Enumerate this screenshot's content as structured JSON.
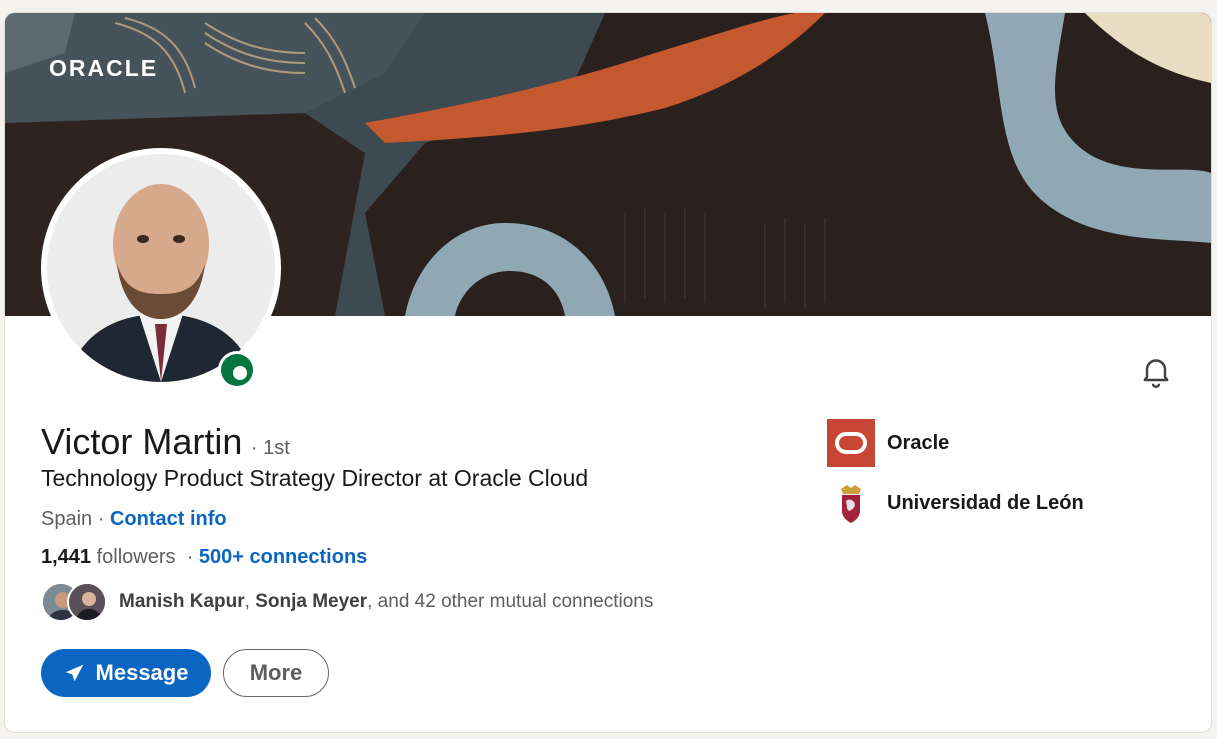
{
  "banner": {
    "logo_text": "ORACLE"
  },
  "profile": {
    "name": "Victor Martin",
    "degree": "· 1st",
    "headline": "Technology Product Strategy Director at Oracle Cloud",
    "location": "Spain",
    "location_separator": " · ",
    "contact_info_label": "Contact info",
    "followers_count": "1,441",
    "followers_label": " followers",
    "followers_separator": "  · ",
    "connections_label": "500+ connections",
    "presence_status": "online"
  },
  "mutual": {
    "name1": "Manish Kapur",
    "separator": ", ",
    "name2": "Sonja Meyer",
    "rest": ", and 42 other mutual connections"
  },
  "actions": {
    "message_label": "Message",
    "more_label": "More"
  },
  "experience_summary": [
    {
      "name": "Oracle",
      "logo": "oracle-logo"
    },
    {
      "name": "Universidad de León",
      "logo": "university-crest"
    }
  ],
  "colors": {
    "accent": "#0a66c2",
    "presence": "#057642",
    "oracle_red": "#c74634"
  }
}
